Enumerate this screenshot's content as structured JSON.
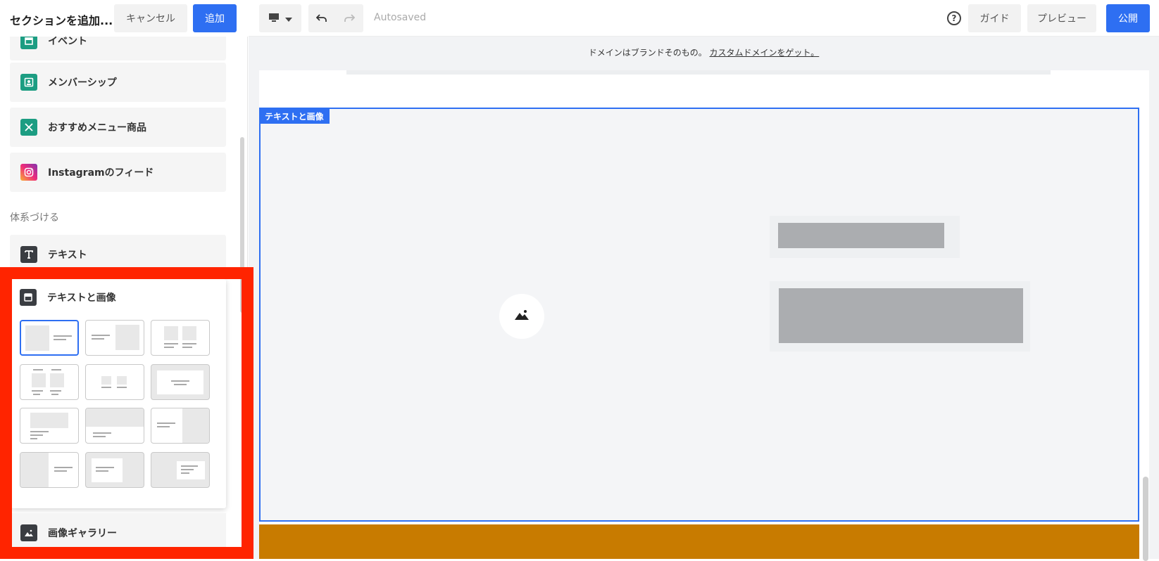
{
  "left_panel": {
    "title": "セクションを追加...",
    "cancel_label": "キャンセル",
    "add_label": "追加",
    "items_top": [
      {
        "label": "イベント",
        "icon": "calendar-icon",
        "color": "#1c9d82"
      },
      {
        "label": "メンバーシップ",
        "icon": "membership-icon",
        "color": "#1c9d82"
      },
      {
        "label": "おすすめメニュー商品",
        "icon": "utensils-icon",
        "color": "#1c9d82"
      },
      {
        "label": "Instagramのフィード",
        "icon": "instagram-icon",
        "color": "#e1306c"
      }
    ],
    "group_heading": "体系づける",
    "text_item": {
      "label": "テキスト",
      "icon": "text-icon"
    },
    "text_image_card": {
      "label": "テキストと画像",
      "icon": "text-image-icon",
      "layouts": [
        "layout-1",
        "layout-2",
        "layout-3",
        "layout-4",
        "layout-5",
        "layout-6",
        "layout-7",
        "layout-8",
        "layout-9",
        "layout-10",
        "layout-11",
        "layout-12"
      ],
      "selected_index": 0
    },
    "gallery_item": {
      "label": "画像ギャラリー",
      "icon": "gallery-icon"
    },
    "highlight_color": "#ff2400"
  },
  "topbar": {
    "device_icon": "desktop-icon",
    "autosaved": "Autosaved",
    "help_glyph": "?",
    "guide_label": "ガイド",
    "preview_label": "プレビュー",
    "publish_label": "公開",
    "accent": "#2e6ff2"
  },
  "canvas": {
    "banner_text": "ドメインはブランドそのもの。",
    "banner_link": "カスタムドメインをゲット。",
    "section_tag": "テキストと画像",
    "footer_color": "#c87b00"
  }
}
